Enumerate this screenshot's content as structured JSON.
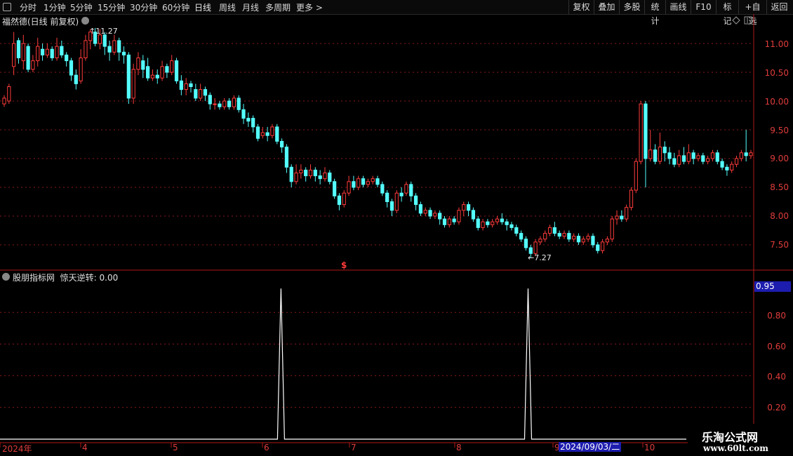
{
  "toolbar": {
    "window_icon": "window-icon",
    "periods": [
      "分时",
      "1分钟",
      "5分钟",
      "15分钟",
      "30分钟",
      "60分钟",
      "日线",
      "周线",
      "月线",
      "多周期",
      "更多 >"
    ],
    "active_period": "日线",
    "right_buttons": [
      "复权",
      "叠加",
      "多股",
      "统计",
      "画线",
      "F10",
      "标记",
      "+自选",
      "返回"
    ]
  },
  "main_panel": {
    "title": "福然德(日线 前复权)",
    "high_label": "11.27",
    "low_label": "7.27",
    "y_ticks": [
      "11.00",
      "10.50",
      "10.00",
      "9.50",
      "9.00",
      "8.50",
      "8.00",
      "7.50"
    ],
    "marker": "$"
  },
  "indicator_panel": {
    "name": "股朋指标网",
    "indicator_label": "惊天逆转:",
    "indicator_value": "0.00",
    "current_value": "0.95",
    "y_ticks": [
      "0.80",
      "0.60",
      "0.40",
      "0.20"
    ]
  },
  "x_axis": {
    "labels": [
      "2024年",
      "4",
      "5",
      "6",
      "7",
      "8",
      "9",
      "10"
    ],
    "cursor_date": "2024/09/03/二"
  },
  "watermark": {
    "line1": "乐淘公式网",
    "line2": "www.60lt.com"
  },
  "colors": {
    "up": "#ff3b3b",
    "down": "#54ffff",
    "axis": "#b01818",
    "cursor_box": "#1c1cae"
  },
  "chart_data": [
    {
      "type": "candlestick",
      "title": "福然德(日线 前复权)",
      "ylim": [
        7.2,
        11.4
      ],
      "x_axis_labels": [
        "2024年",
        "4",
        "5",
        "6",
        "7",
        "8",
        "9",
        "10"
      ],
      "annotations": [
        {
          "label": "11.27",
          "type": "high"
        },
        {
          "label": "7.27",
          "type": "low"
        }
      ],
      "ohlc": [
        [
          9.95,
          10.05,
          9.9,
          10.1
        ],
        [
          10.0,
          10.25,
          9.95,
          10.3
        ],
        [
          10.6,
          11.0,
          10.45,
          11.2
        ],
        [
          11.05,
          10.75,
          10.65,
          11.1
        ],
        [
          10.7,
          11.0,
          10.55,
          11.15
        ],
        [
          10.95,
          10.55,
          10.5,
          11.0
        ],
        [
          10.55,
          10.7,
          10.5,
          10.8
        ],
        [
          10.7,
          10.95,
          10.6,
          11.1
        ],
        [
          10.9,
          10.8,
          10.7,
          11.0
        ],
        [
          10.8,
          10.9,
          10.75,
          11.0
        ],
        [
          10.9,
          10.75,
          10.7,
          10.95
        ],
        [
          10.75,
          10.95,
          10.7,
          11.1
        ],
        [
          10.95,
          10.8,
          10.75,
          11.05
        ],
        [
          10.8,
          10.7,
          10.6,
          10.85
        ],
        [
          10.7,
          10.45,
          10.35,
          10.75
        ],
        [
          10.45,
          10.3,
          10.2,
          10.55
        ],
        [
          10.35,
          10.75,
          10.3,
          10.9
        ],
        [
          10.75,
          11.05,
          10.7,
          11.15
        ],
        [
          11.05,
          11.2,
          10.9,
          11.25
        ],
        [
          11.2,
          11.0,
          10.95,
          11.27
        ],
        [
          11.0,
          11.15,
          10.9,
          11.25
        ],
        [
          11.15,
          10.95,
          10.8,
          11.2
        ],
        [
          10.95,
          10.85,
          10.7,
          11.05
        ],
        [
          10.85,
          11.05,
          10.8,
          11.15
        ],
        [
          11.05,
          10.85,
          10.7,
          11.1
        ],
        [
          10.85,
          10.8,
          10.65,
          10.95
        ],
        [
          10.8,
          10.05,
          9.95,
          10.85
        ],
        [
          10.05,
          10.55,
          9.95,
          10.65
        ],
        [
          10.55,
          10.75,
          10.45,
          10.85
        ],
        [
          10.7,
          10.55,
          10.4,
          10.8
        ],
        [
          10.6,
          10.4,
          10.35,
          10.75
        ],
        [
          10.4,
          10.45,
          10.35,
          10.55
        ],
        [
          10.45,
          10.4,
          10.3,
          10.55
        ],
        [
          10.4,
          10.6,
          10.35,
          10.7
        ],
        [
          10.6,
          10.5,
          10.4,
          10.65
        ],
        [
          10.5,
          10.7,
          10.45,
          10.8
        ],
        [
          10.7,
          10.35,
          10.3,
          10.75
        ],
        [
          10.35,
          10.2,
          10.1,
          10.45
        ],
        [
          10.2,
          10.3,
          10.1,
          10.4
        ],
        [
          10.3,
          10.25,
          10.15,
          10.35
        ],
        [
          10.2,
          10.05,
          10.0,
          10.3
        ],
        [
          10.05,
          10.2,
          10.0,
          10.3
        ],
        [
          10.2,
          10.1,
          10.0,
          10.25
        ],
        [
          10.1,
          9.95,
          9.85,
          10.15
        ],
        [
          9.95,
          9.95,
          9.85,
          10.05
        ],
        [
          9.95,
          9.9,
          9.85,
          10.0
        ],
        [
          9.9,
          10.0,
          9.85,
          10.05
        ],
        [
          10.0,
          9.9,
          9.85,
          10.05
        ],
        [
          9.9,
          10.05,
          9.85,
          10.1
        ],
        [
          10.05,
          9.85,
          9.8,
          10.1
        ],
        [
          9.85,
          9.7,
          9.6,
          9.95
        ],
        [
          9.7,
          9.65,
          9.55,
          9.8
        ],
        [
          9.7,
          9.55,
          9.45,
          9.75
        ],
        [
          9.55,
          9.35,
          9.3,
          9.6
        ],
        [
          9.4,
          9.45,
          9.35,
          9.55
        ],
        [
          9.45,
          9.4,
          9.3,
          9.55
        ],
        [
          9.4,
          9.55,
          9.35,
          9.6
        ],
        [
          9.55,
          9.3,
          9.25,
          9.6
        ],
        [
          9.3,
          9.2,
          9.1,
          9.35
        ],
        [
          9.2,
          8.85,
          8.75,
          9.25
        ],
        [
          8.85,
          8.6,
          8.5,
          8.9
        ],
        [
          8.6,
          8.75,
          8.55,
          8.9
        ],
        [
          8.75,
          8.8,
          8.65,
          8.9
        ],
        [
          8.8,
          8.7,
          8.6,
          8.85
        ],
        [
          8.7,
          8.8,
          8.65,
          8.9
        ],
        [
          8.8,
          8.7,
          8.6,
          8.85
        ],
        [
          8.7,
          8.65,
          8.55,
          8.8
        ],
        [
          8.65,
          8.75,
          8.6,
          8.85
        ],
        [
          8.75,
          8.6,
          8.55,
          8.8
        ],
        [
          8.6,
          8.35,
          8.3,
          8.65
        ],
        [
          8.35,
          8.2,
          8.1,
          8.4
        ],
        [
          8.2,
          8.4,
          8.15,
          8.45
        ],
        [
          8.4,
          8.6,
          8.35,
          8.7
        ],
        [
          8.6,
          8.5,
          8.45,
          8.7
        ],
        [
          8.5,
          8.65,
          8.45,
          8.7
        ],
        [
          8.65,
          8.55,
          8.5,
          8.7
        ],
        [
          8.55,
          8.6,
          8.5,
          8.65
        ],
        [
          8.6,
          8.65,
          8.55,
          8.7
        ],
        [
          8.65,
          8.55,
          8.5,
          8.7
        ],
        [
          8.55,
          8.4,
          8.35,
          8.6
        ],
        [
          8.4,
          8.25,
          8.15,
          8.45
        ],
        [
          8.25,
          8.1,
          8.0,
          8.3
        ],
        [
          8.1,
          8.4,
          8.05,
          8.45
        ],
        [
          8.4,
          8.35,
          8.25,
          8.5
        ],
        [
          8.4,
          8.55,
          8.35,
          8.6
        ],
        [
          8.55,
          8.35,
          8.25,
          8.6
        ],
        [
          8.35,
          8.2,
          8.1,
          8.4
        ],
        [
          8.2,
          8.05,
          8.0,
          8.25
        ],
        [
          8.05,
          8.1,
          8.0,
          8.15
        ],
        [
          8.1,
          8.0,
          7.95,
          8.15
        ],
        [
          8.0,
          8.05,
          7.95,
          8.1
        ],
        [
          8.05,
          7.95,
          7.85,
          8.1
        ],
        [
          7.95,
          7.85,
          7.8,
          8.0
        ],
        [
          7.85,
          7.95,
          7.8,
          8.0
        ],
        [
          7.95,
          7.9,
          7.85,
          8.0
        ],
        [
          7.9,
          8.1,
          7.85,
          8.15
        ],
        [
          8.1,
          8.2,
          8.0,
          8.25
        ],
        [
          8.2,
          8.1,
          8.0,
          8.25
        ],
        [
          8.1,
          7.95,
          7.9,
          8.15
        ],
        [
          7.95,
          7.8,
          7.75,
          8.0
        ],
        [
          7.8,
          7.9,
          7.75,
          7.95
        ],
        [
          7.9,
          7.85,
          7.8,
          7.95
        ],
        [
          7.85,
          7.9,
          7.8,
          7.95
        ],
        [
          7.9,
          7.95,
          7.85,
          8.0
        ],
        [
          7.95,
          7.9,
          7.85,
          8.05
        ],
        [
          7.9,
          7.85,
          7.75,
          7.95
        ],
        [
          7.85,
          7.8,
          7.75,
          7.9
        ],
        [
          7.8,
          7.7,
          7.65,
          7.85
        ],
        [
          7.7,
          7.6,
          7.55,
          7.75
        ],
        [
          7.6,
          7.45,
          7.4,
          7.65
        ],
        [
          7.45,
          7.35,
          7.27,
          7.5
        ],
        [
          7.35,
          7.55,
          7.3,
          7.6
        ],
        [
          7.55,
          7.6,
          7.5,
          7.65
        ],
        [
          7.6,
          7.7,
          7.55,
          7.75
        ],
        [
          7.7,
          7.8,
          7.65,
          7.85
        ],
        [
          7.8,
          7.7,
          7.65,
          7.9
        ],
        [
          7.7,
          7.65,
          7.6,
          7.75
        ],
        [
          7.65,
          7.7,
          7.6,
          7.75
        ],
        [
          7.7,
          7.6,
          7.55,
          7.75
        ],
        [
          7.6,
          7.65,
          7.55,
          7.7
        ],
        [
          7.65,
          7.55,
          7.5,
          7.7
        ],
        [
          7.55,
          7.6,
          7.5,
          7.65
        ],
        [
          7.6,
          7.65,
          7.55,
          7.7
        ],
        [
          7.65,
          7.5,
          7.45,
          7.7
        ],
        [
          7.5,
          7.4,
          7.35,
          7.55
        ],
        [
          7.4,
          7.55,
          7.35,
          7.6
        ],
        [
          7.55,
          7.6,
          7.5,
          7.65
        ],
        [
          7.6,
          7.95,
          7.55,
          8.0
        ],
        [
          7.95,
          8.0,
          7.85,
          8.1
        ],
        [
          8.0,
          7.95,
          7.9,
          8.1
        ],
        [
          7.95,
          8.15,
          7.9,
          8.2
        ],
        [
          8.15,
          8.45,
          8.1,
          8.5
        ],
        [
          8.45,
          8.95,
          8.4,
          9.0
        ],
        [
          8.95,
          9.95,
          8.9,
          10.0
        ],
        [
          9.95,
          9.0,
          8.5,
          10.0
        ],
        [
          9.0,
          9.15,
          8.95,
          9.5
        ],
        [
          9.15,
          8.95,
          8.9,
          9.25
        ],
        [
          8.95,
          9.2,
          8.9,
          9.45
        ],
        [
          9.2,
          9.1,
          8.95,
          9.3
        ],
        [
          9.1,
          9.0,
          8.9,
          9.2
        ],
        [
          9.0,
          8.9,
          8.85,
          9.1
        ],
        [
          8.9,
          9.05,
          8.85,
          9.15
        ],
        [
          9.05,
          8.95,
          8.9,
          9.2
        ],
        [
          8.95,
          9.1,
          8.9,
          9.25
        ],
        [
          9.1,
          9.0,
          8.9,
          9.15
        ],
        [
          9.0,
          9.05,
          8.95,
          9.1
        ],
        [
          9.05,
          8.95,
          8.9,
          9.1
        ],
        [
          8.95,
          9.0,
          8.9,
          9.05
        ],
        [
          9.0,
          9.1,
          8.95,
          9.15
        ],
        [
          9.1,
          8.95,
          8.9,
          9.15
        ],
        [
          8.95,
          8.85,
          8.8,
          9.0
        ],
        [
          8.85,
          8.8,
          8.7,
          8.9
        ],
        [
          8.8,
          8.9,
          8.75,
          8.95
        ],
        [
          8.9,
          9.0,
          8.85,
          9.05
        ],
        [
          9.0,
          9.1,
          8.95,
          9.15
        ],
        [
          9.1,
          9.05,
          8.95,
          9.5
        ],
        [
          9.05,
          9.1,
          9.0,
          9.15
        ]
      ]
    },
    {
      "type": "line",
      "title": "",
      "series": [
        {
          "name": "惊天逆转",
          "spikes": [
            {
              "at_fraction": 0.398,
              "value": 0.95
            },
            {
              "at_fraction": 0.748,
              "value": 0.95
            }
          ]
        }
      ],
      "ylim": [
        0,
        1.0
      ],
      "current_value": 0.0
    }
  ]
}
